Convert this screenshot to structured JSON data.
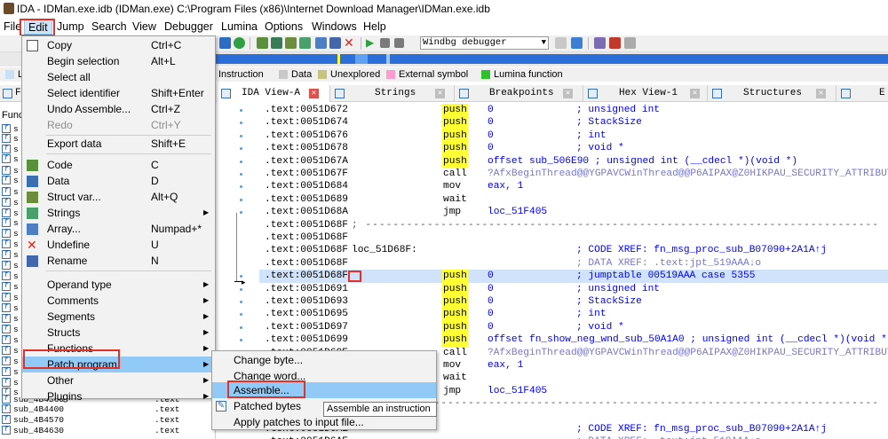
{
  "window": {
    "title": "IDA - IDMan.exe.idb (IDMan.exe) C:\\Program Files (x86)\\Internet Download Manager\\IDMan.exe.idb"
  },
  "menubar": [
    "File",
    "Edit",
    "Jump",
    "Search",
    "View",
    "Debugger",
    "Lumina",
    "Options",
    "Windows",
    "Help"
  ],
  "toolbar": {
    "debugger_select": "Windbg debugger"
  },
  "legend": [
    {
      "label": "Instruction",
      "color": "#c0c0c0"
    },
    {
      "label": "Data",
      "color": "#c8c8c8"
    },
    {
      "label": "Unexplored",
      "color": "#c8c37a"
    },
    {
      "label": "External symbol",
      "color": "#ff9ccf"
    },
    {
      "label": "Lumina function",
      "color": "#2fbf2f"
    }
  ],
  "legend_left_letter": "L",
  "tabs": [
    "IDA View-A",
    "Strings",
    "Breakpoints",
    "Hex View-1",
    "Structures",
    "E"
  ],
  "functions_panel": {
    "tab": "Fu",
    "header": "Func",
    "visible_rows": [
      {
        "name": "sub_4B4360",
        "seg": ".text"
      },
      {
        "name": "sub_4B4400",
        "seg": ".text"
      },
      {
        "name": "sub_4B4570",
        "seg": ".text"
      },
      {
        "name": "sub_4B4630",
        "seg": ".text"
      }
    ],
    "row_prefix": "s"
  },
  "code_lines": [
    {
      "addr": ".text:0051D672",
      "mn": "push",
      "op": "0",
      "cm": "; unsigned int"
    },
    {
      "addr": ".text:0051D674",
      "mn": "push",
      "op": "0",
      "cm": "; StackSize"
    },
    {
      "addr": ".text:0051D676",
      "mn": "push",
      "op": "0",
      "cm": "; int"
    },
    {
      "addr": ".text:0051D678",
      "mn": "push",
      "op": "0",
      "cm": "; void *"
    },
    {
      "addr": ".text:0051D67A",
      "mn": "push",
      "op": "offset sub_506E90 ; unsigned int (__cdecl *)(void *)"
    },
    {
      "addr": ".text:0051D67F",
      "mn": "call",
      "op": "?AfxBeginThread@@YGPAVCWinThread@@P6AIPAX@Z0HIKPAU_SECURITY_ATTRIBUTES@@@Z",
      "opclass": "lav"
    },
    {
      "addr": ".text:0051D684",
      "mn": "mov",
      "op": "eax, 1"
    },
    {
      "addr": ".text:0051D689",
      "mn": "wait",
      "op": ""
    },
    {
      "addr": ".text:0051D68A",
      "mn": "jmp",
      "op": "loc_51F405"
    },
    {
      "addr": ".text:0051D68F",
      "lbl": "; ---------------------------------------------------------------------------"
    },
    {
      "addr": ".text:0051D68F"
    },
    {
      "addr": ".text:0051D68F",
      "lbl": "loc_51D68F:",
      "cm": "; CODE XREF: fn_msg_proc_sub_B07090+2A1A↑j"
    },
    {
      "addr": ".text:0051D68F",
      "cm": "; DATA XREF: .text:jpt_519AAA↓o",
      "cmclass": "xref2"
    },
    {
      "addr": ".text:0051D68F",
      "mn": "push",
      "op": "0",
      "cm": "; jumptable 00519AAA case 5355",
      "hl": true
    },
    {
      "addr": ".text:0051D691",
      "mn": "push",
      "op": "0",
      "cm": "; unsigned int"
    },
    {
      "addr": ".text:0051D693",
      "mn": "push",
      "op": "0",
      "cm": "; StackSize"
    },
    {
      "addr": ".text:0051D695",
      "mn": "push",
      "op": "0",
      "cm": "; int"
    },
    {
      "addr": ".text:0051D697",
      "mn": "push",
      "op": "0",
      "cm": "; void *"
    },
    {
      "addr": ".text:0051D699",
      "mn": "push",
      "op": "offset fn_show_neg_wnd_sub_50A1A0 ; unsigned int (__cdecl *)(void *)"
    },
    {
      "addr": ".text:0051D69E",
      "mn": "call",
      "op": "?AfxBeginThread@@YGPAVCWinThread@@P6AIPAX@Z0HIKPAU_SECURITY_ATTRIBUTES@@@Z",
      "opclass": "lav"
    },
    {
      "addr": ".text:0051D6A3",
      "mn": "mov",
      "op": "eax, 1"
    },
    {
      "addr": ".text:0051D6A8",
      "mn": "wait",
      "op": ""
    },
    {
      "addr": ".text:0051D6A9",
      "mn": "jmp",
      "op": "loc_51F405"
    },
    {
      "addr": ".text:0051D6AE",
      "lbl": "; ---------------------------------------------------------------------------"
    },
    {
      "addr": ".text:0051D6AE"
    },
    {
      "addr": ".text:0051D6AE",
      "cm": "; CODE XREF: fn_msg_proc_sub_B07090+2A1A↑j"
    },
    {
      "addr": ".text:0051D6AE",
      "cm": "; DATA XREF: .text:jpt_519AAA↓o",
      "cmclass": "xref2"
    }
  ],
  "edit_menu": [
    {
      "label": "Copy",
      "shortcut": "Ctrl+C",
      "icon": "copy-icon"
    },
    {
      "label": "Begin selection",
      "shortcut": "Alt+L"
    },
    {
      "label": "Select all",
      "shortcut": ""
    },
    {
      "label": "Select identifier",
      "shortcut": "Shift+Enter"
    },
    {
      "label": "Undo Assemble...",
      "shortcut": "Ctrl+Z"
    },
    {
      "label": "Redo",
      "shortcut": "Ctrl+Y",
      "disabled": true
    },
    {
      "sep": true
    },
    {
      "label": "Export data",
      "shortcut": "Shift+E"
    },
    {
      "sep": true
    },
    {
      "label": "Code",
      "shortcut": "C",
      "icon": "code-icon"
    },
    {
      "label": "Data",
      "shortcut": "D",
      "icon": "data-icon"
    },
    {
      "label": "Struct var...",
      "shortcut": "Alt+Q",
      "icon": "struct-icon"
    },
    {
      "label": "Strings",
      "shortcut": "",
      "submenu": true,
      "icon": "strings-icon"
    },
    {
      "label": "Array...",
      "shortcut": "Numpad+*",
      "icon": "array-icon"
    },
    {
      "label": "Undefine",
      "shortcut": "U",
      "icon": "undefine-icon"
    },
    {
      "label": "Rename",
      "shortcut": "N",
      "icon": "rename-icon"
    },
    {
      "sep": true
    },
    {
      "label": "Operand type",
      "shortcut": "",
      "submenu": true
    },
    {
      "label": "Comments",
      "shortcut": "",
      "submenu": true
    },
    {
      "label": "Segments",
      "shortcut": "",
      "submenu": true
    },
    {
      "label": "Structs",
      "shortcut": "",
      "submenu": true
    },
    {
      "label": "Functions",
      "shortcut": "",
      "submenu": true
    },
    {
      "label": "Patch program",
      "shortcut": "",
      "submenu": true,
      "selected": true
    },
    {
      "label": "Other",
      "shortcut": "",
      "submenu": true
    },
    {
      "label": "Plugins",
      "shortcut": "",
      "submenu": true
    }
  ],
  "patch_submenu": [
    {
      "label": "Change byte..."
    },
    {
      "label": "Change word..."
    },
    {
      "label": "Assemble...",
      "selected": true
    },
    {
      "label": "Patched bytes",
      "icon": "patched-bytes-icon"
    },
    {
      "label": "Apply patches to input file..."
    }
  ],
  "tooltip": "Assemble an instruction",
  "colors": {
    "accent": "#91c9f7",
    "annotation_red": "#e0312b",
    "push_highlight": "#ffff33",
    "nav_blue": "#2d6fd9"
  }
}
